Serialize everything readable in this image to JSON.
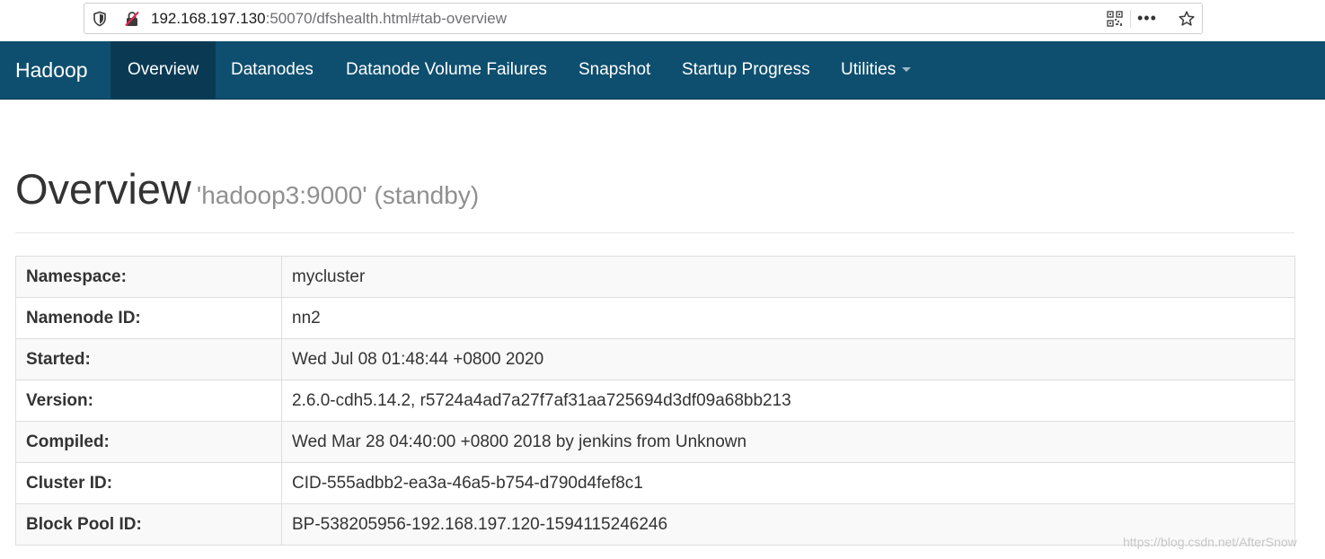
{
  "browser": {
    "url_host": "192.168.197.130",
    "url_rest": ":50070/dfshealth.html#tab-overview",
    "more_label": "•••"
  },
  "navbar": {
    "brand": "Hadoop",
    "items": [
      {
        "label": "Overview",
        "active": true
      },
      {
        "label": "Datanodes"
      },
      {
        "label": "Datanode Volume Failures"
      },
      {
        "label": "Snapshot"
      },
      {
        "label": "Startup Progress"
      },
      {
        "label": "Utilities"
      }
    ],
    "colors": {
      "background": "#0e4f6f",
      "active": "#0a3a53"
    }
  },
  "page": {
    "title": "Overview",
    "subtitle": "'hadoop3:9000' (standby)"
  },
  "overview_table": [
    {
      "key": "Namespace:",
      "value": "mycluster"
    },
    {
      "key": "Namenode ID:",
      "value": "nn2"
    },
    {
      "key": "Started:",
      "value": "Wed Jul 08 01:48:44 +0800 2020"
    },
    {
      "key": "Version:",
      "value": "2.6.0-cdh5.14.2, r5724a4ad7a27f7af31aa725694d3df09a68bb213"
    },
    {
      "key": "Compiled:",
      "value": "Wed Mar 28 04:40:00 +0800 2018 by jenkins from Unknown"
    },
    {
      "key": "Cluster ID:",
      "value": "CID-555adbb2-ea3a-46a5-b754-d790d4fef8c1"
    },
    {
      "key": "Block Pool ID:",
      "value": "BP-538205956-192.168.197.120-1594115246246"
    }
  ],
  "watermark": "https://blog.csdn.net/AfterSnow"
}
